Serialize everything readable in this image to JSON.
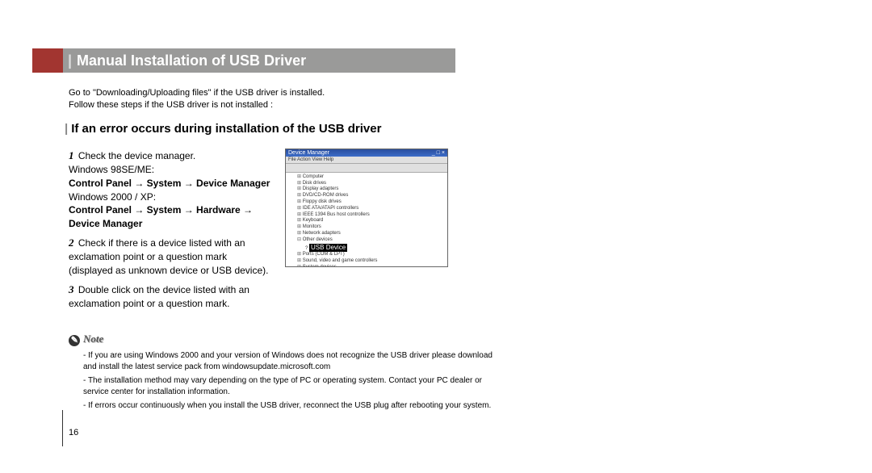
{
  "title": "Manual Installation of USB Driver",
  "intro1": "Go to \"Downloading/Uploading files\" if the USB driver is installed.",
  "intro2": "Follow these steps if the USB driver is not installed :",
  "section": "If an error occurs during installation of the USB driver",
  "steps": {
    "s1_a": "Check the device manager.",
    "s1_b": "Windows 98SE/ME:",
    "s1_c": "Control Panel → System → Device Manager",
    "s1_d": "Windows 2000 / XP:",
    "s1_e": "Control Panel → System → Hardware → Device Manager",
    "s2": "Check if there is a device listed with an exclamation point or a question mark (displayed as unknown device or USB device).",
    "s3": "Double click on the device listed with an exclamation point or a question mark."
  },
  "devmgr": {
    "title": "Device Manager",
    "menu": "File   Action   View   Help",
    "rows": [
      "Computer",
      "Disk drives",
      "Display adapters",
      "DVD/CD-ROM drives",
      "Floppy disk drives",
      "IDE ATA/ATAPI controllers",
      "IEEE 1394 Bus host controllers",
      "Keyboard",
      "Monitors",
      "Network adapters"
    ],
    "other": "Other devices",
    "highlight": "USB Device",
    "more": [
      "Ports (COM & LPT)",
      "Sound, video and game controllers",
      "System devices"
    ]
  },
  "note_label": "Note",
  "notes": [
    "If you are using Windows 2000 and your version of Windows does not recognize the USB driver please download and install the latest service pack from windowsupdate.microsoft.com",
    "The installation method may vary depending on the type of PC or operating system. Contact your PC dealer or service center for installation information.",
    "If errors occur continuously when you install the USB driver, reconnect the USB plug after rebooting your system."
  ],
  "page_num": "16"
}
